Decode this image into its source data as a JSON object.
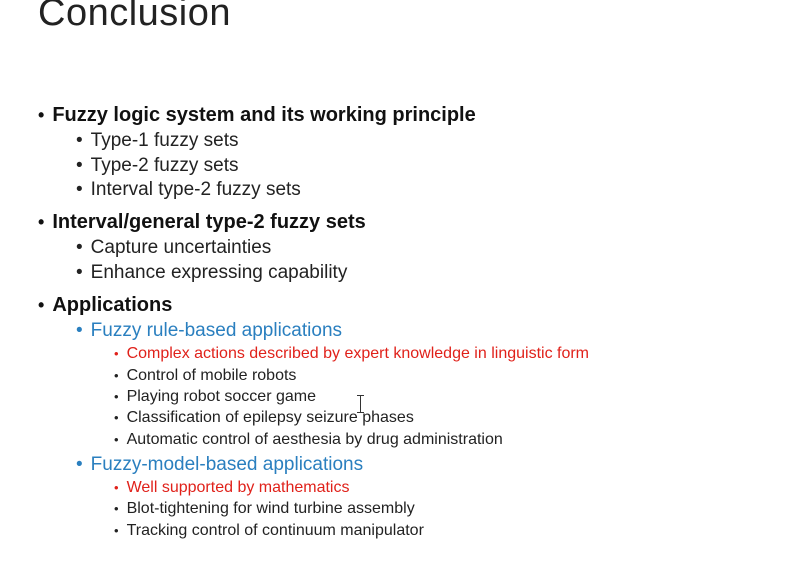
{
  "slide": {
    "title": "Conclusion",
    "bullet_char": "•",
    "sections": [
      {
        "heading": "Fuzzy logic system and its working principle",
        "items": [
          "Type-1 fuzzy sets",
          "Type-2 fuzzy sets",
          "Interval type-2 fuzzy sets"
        ]
      },
      {
        "heading": "Interval/general type-2 fuzzy sets",
        "items": [
          "Capture uncertainties",
          "Enhance expressing capability"
        ]
      },
      {
        "heading": "Applications",
        "groups": [
          {
            "label": "Fuzzy rule-based applications",
            "highlight": "Complex actions described by expert knowledge in linguistic form",
            "items": [
              "Control of mobile robots",
              "Playing robot soccer game",
              "Classification of epilepsy seizure phases",
              "Automatic control of aesthesia by drug administration"
            ]
          },
          {
            "label": "Fuzzy-model-based applications",
            "highlight": "Well supported by mathematics",
            "items": [
              "Blot-tightening for wind turbine assembly",
              "Tracking control of continuum manipulator"
            ]
          }
        ]
      }
    ]
  },
  "colors": {
    "blue_text": "#2a7fbf",
    "red_text": "#e0211a",
    "body_text": "#222222"
  }
}
